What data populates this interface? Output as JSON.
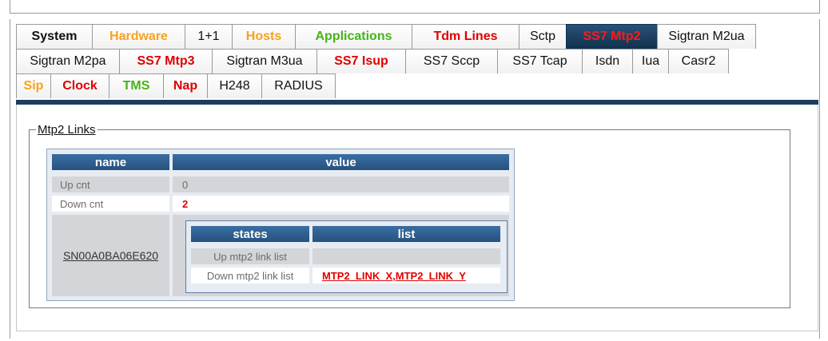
{
  "tabs": {
    "row1": [
      {
        "label": "System",
        "color": "black"
      },
      {
        "label": "Hardware",
        "color": "orange"
      },
      {
        "label": "1+1",
        "color": "plain"
      },
      {
        "label": "Hosts",
        "color": "orange"
      },
      {
        "label": "Applications",
        "color": "green"
      },
      {
        "label": "Tdm Lines",
        "color": "red"
      },
      {
        "label": "Sctp",
        "color": "plain"
      },
      {
        "label": "SS7 Mtp2",
        "color": "red",
        "active": true
      },
      {
        "label": "Sigtran M2ua",
        "color": "plain"
      }
    ],
    "row2": [
      {
        "label": "Sigtran M2pa",
        "color": "plain"
      },
      {
        "label": "SS7 Mtp3",
        "color": "red"
      },
      {
        "label": "Sigtran M3ua",
        "color": "plain"
      },
      {
        "label": "SS7 Isup",
        "color": "red"
      },
      {
        "label": "SS7 Sccp",
        "color": "plain"
      },
      {
        "label": "SS7 Tcap",
        "color": "plain"
      },
      {
        "label": "Isdn",
        "color": "plain"
      },
      {
        "label": "Iua",
        "color": "plain"
      },
      {
        "label": "Casr2",
        "color": "plain"
      }
    ],
    "row3": [
      {
        "label": "Sip",
        "color": "orange"
      },
      {
        "label": "Clock",
        "color": "red"
      },
      {
        "label": "TMS",
        "color": "green"
      },
      {
        "label": "Nap",
        "color": "red"
      },
      {
        "label": "H248",
        "color": "plain"
      },
      {
        "label": "RADIUS",
        "color": "plain"
      }
    ]
  },
  "section": {
    "legend": "Mtp2 Links",
    "table": {
      "col_name": "name",
      "col_value": "value",
      "rows": [
        {
          "name": "Up cnt",
          "value": "0"
        },
        {
          "name": "Down cnt",
          "value": "2"
        }
      ],
      "link_name": "SN00A0BA06E620",
      "sub": {
        "col_states": "states",
        "col_list": "list",
        "up_label": "Up mtp2 link list",
        "down_label": "Down mtp2 link list",
        "down_links": [
          "MTP2_LINK_X",
          "MTP2_LINK_Y"
        ],
        "separator": ", "
      }
    }
  },
  "colors": {
    "accent_bar": "#1d3e5c",
    "header_blue": "#2f5f90",
    "red": "#e00000",
    "orange": "#f7a21b",
    "green": "#46b319"
  }
}
